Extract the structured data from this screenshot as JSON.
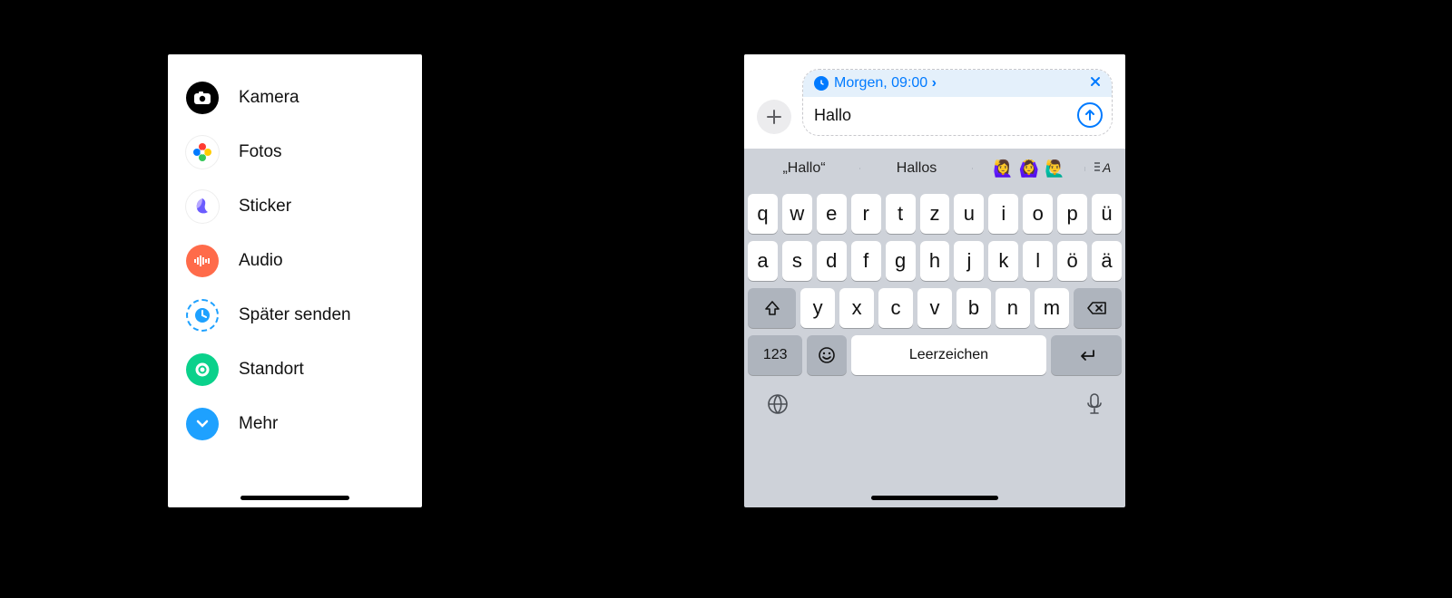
{
  "left_menu": {
    "items": [
      {
        "label": "Kamera"
      },
      {
        "label": "Fotos"
      },
      {
        "label": "Sticker"
      },
      {
        "label": "Audio"
      },
      {
        "label": "Später senden"
      },
      {
        "label": "Standort"
      },
      {
        "label": "Mehr"
      }
    ]
  },
  "compose": {
    "schedule_text": "Morgen, 09:00",
    "input_value": "Hallo"
  },
  "suggestions": {
    "s1": "„Hallo“",
    "s2": "Hallos",
    "emoji1": "🙋‍♀️",
    "emoji2": "🙆‍♀️",
    "emoji3": "🙋‍♂️"
  },
  "keyboard": {
    "row1": [
      "q",
      "w",
      "e",
      "r",
      "t",
      "z",
      "u",
      "i",
      "o",
      "p",
      "ü"
    ],
    "row2": [
      "a",
      "s",
      "d",
      "f",
      "g",
      "h",
      "j",
      "k",
      "l",
      "ö",
      "ä"
    ],
    "row3": [
      "y",
      "x",
      "c",
      "v",
      "b",
      "n",
      "m"
    ],
    "numeric_label": "123",
    "space_label": "Leerzeichen"
  }
}
